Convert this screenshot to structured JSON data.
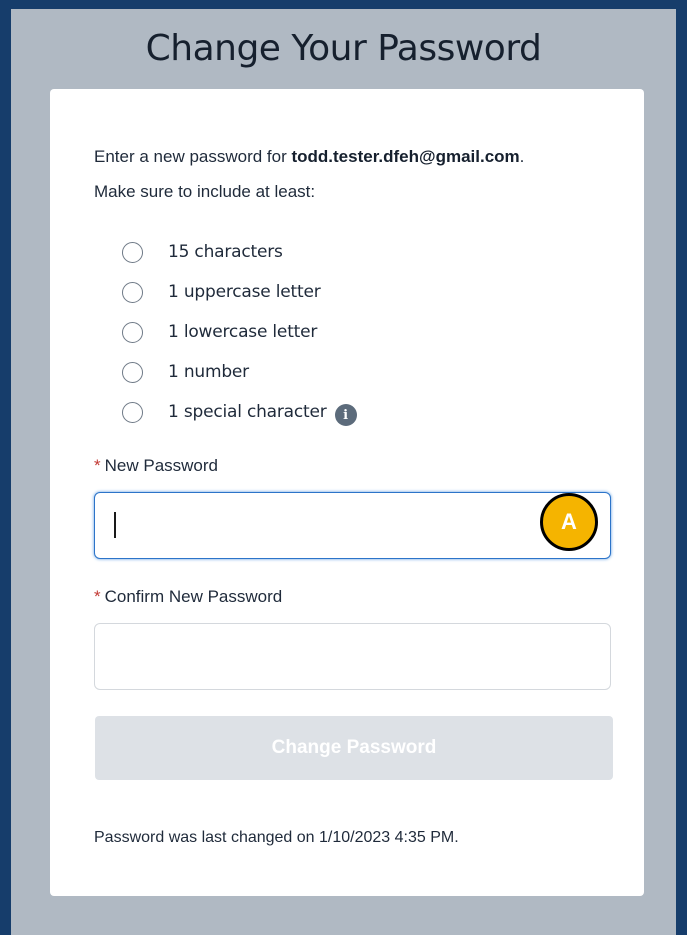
{
  "page": {
    "title": "Change Your Password"
  },
  "intro": {
    "prefix": "Enter a new password for ",
    "email": "todd.tester.dfeh@gmail.com",
    "suffix": ".",
    "requirements_heading": "Make sure to include at least:"
  },
  "requirements": [
    {
      "label": "15 characters"
    },
    {
      "label": "1 uppercase letter"
    },
    {
      "label": "1 lowercase letter"
    },
    {
      "label": "1 number"
    },
    {
      "label": "1 special character",
      "icon": "info-icon"
    }
  ],
  "fields": {
    "required_marker": "*",
    "new_password": {
      "label": "New Password",
      "value": "",
      "focused": true
    },
    "confirm_password": {
      "label": "Confirm New Password",
      "value": ""
    }
  },
  "annotation_marker": {
    "text": "A",
    "color": "#f5b400"
  },
  "submit": {
    "label": "Change Password",
    "disabled": true
  },
  "footer": {
    "last_changed": "Password was last changed on 1/10/2023 4:35 PM."
  },
  "colors": {
    "frame": "#163d6b",
    "background": "#b0b9c3",
    "focus": "#2c74c9",
    "required": "#c23934"
  }
}
